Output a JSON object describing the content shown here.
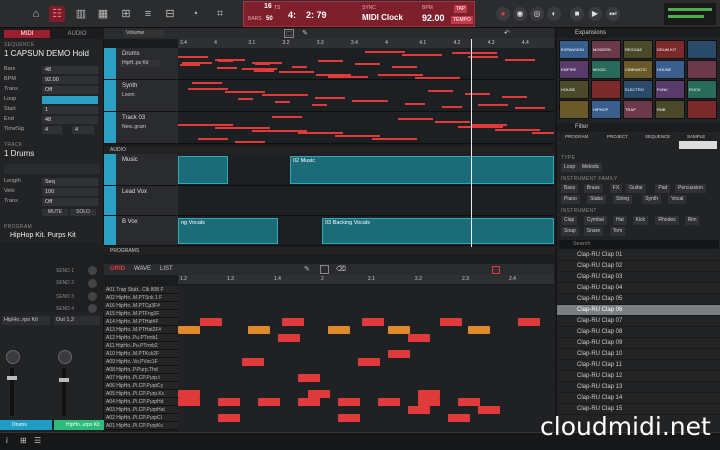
{
  "toolbar": {
    "ts_label": "TS",
    "ts_num": "16",
    "bars_label": "BARS",
    "bars_val": "4:",
    "bars_label2": "50",
    "pos_val": "2:  79",
    "sync_label": "SYNC",
    "sync_val": "MIDI Clock",
    "bpm_label": "BPM",
    "bpm_val": "92.00",
    "tap_label": "TAP",
    "tempo_label": "TEMPO"
  },
  "left": {
    "tab_midi": "MIDI",
    "tab_audio": "AUDIO",
    "seq_hdr": "SEQUENCE",
    "seq_name": "1 CAPSUN DEMO Hold",
    "rows": [
      {
        "k": "Bars",
        "v": "48"
      },
      {
        "k": "BPM",
        "v": "92.00"
      },
      {
        "k": "Trans",
        "v": "Off"
      },
      {
        "k": "Loop",
        "v": ""
      },
      {
        "k": "Start",
        "v": "1"
      },
      {
        "k": "End",
        "v": "48"
      },
      {
        "k": "TimeSig",
        "v": "4"
      }
    ],
    "timesig_den": "4",
    "track_hdr": "TRACK",
    "track_name": "1 Drums",
    "trows": [
      {
        "k": "Length",
        "v": "Seq"
      },
      {
        "k": "Velo",
        "v": "100"
      },
      {
        "k": "Trans",
        "v": "Off"
      }
    ],
    "mute": "MUTE",
    "solo": "SOLO",
    "prog_hdr": "PROGRAM",
    "prog_name": "HipHop Kit. Purps Kit",
    "sends": [
      "SEND 1",
      "SEND 2",
      "SEND 3",
      "SEND 4"
    ],
    "kit_sel": "HipHo..rps Kit",
    "out_sel": "Out 1,2",
    "ch1": "Drums",
    "ch2": "HipHo..urps Kit"
  },
  "tracks": {
    "view": "Volume",
    "ruler": [
      "3.4",
      "4",
      "3.1",
      "3.2",
      "3.3",
      "3.4",
      "4",
      "4.1",
      "4.2",
      "4.3",
      "4.4"
    ],
    "t1": "Drums",
    "t1_prog": "HipH..ps Kit",
    "t2": "Synth",
    "t2_prog": "Loom",
    "t3": "Track 03",
    "t3_prog": "New..gram",
    "audio_hdr": "AUDIO",
    "a1": "Music",
    "a2": "Lead Vox",
    "a3": "B Vox",
    "clip_music": "02 Music",
    "clip_bv1": "ng Vocals",
    "clip_bv2": "03 Backing Vocals",
    "prog_hdr": "PROGRAMS"
  },
  "grid": {
    "tab_grid": "GRID",
    "tab_wave": "WAVE",
    "tab_list": "LIST",
    "ruler": [
      "1.2",
      "1.3",
      "1.4",
      "2",
      "2.1",
      "2.2",
      "2.3",
      "2.4"
    ],
    "pads": [
      "A01 Trap Stutt.. Clk 808 F",
      "A02 HipHo..M.PTSnk 1 F",
      "A16 HipHo..M.PTCp3F#",
      "A15 HipHo..M.PTFng1F",
      "A14 HipHo..M.PTHat#F",
      "A13 HipHo..M.PTHat2F#",
      "A12 HipHo..Pu.PTrmb1",
      "A11 HipHo..Pu.PTrmb2",
      "A10 HipHo..M.PTKck2F",
      "A09 HipHo..Vo.PVoc1F",
      "A08 HipHo..P.Purp.Thd",
      "A07 HipHo..Pi.CP.Purp.t",
      "A06 HipHo..Pi.CP.PurpCy",
      "A05 HipHo..Pi.CP.Purp.Kc",
      "A04 HipHo..Pi.CP.PurpHd",
      "A03 HipHo..Pi.CP.PurpHat",
      "A02 HipHo..Pi.CP.PurpCl",
      "A01 HipHo..Pi.CP.PurpKs"
    ]
  },
  "right": {
    "exp_hdr": "Expansions",
    "filter_hdr": "Filter",
    "ftabs": [
      "PROGRAM",
      "PROJECT",
      "SEQUENCE",
      "SAMPLE"
    ],
    "type_hdr": "TYPE",
    "type": [
      "Loop",
      "Melodic"
    ],
    "fam_hdr": "INSTRUMENT FAMILY",
    "fam": [
      "Bass",
      "Brass",
      "FX",
      "Guitar",
      "Pad",
      "Percussion",
      "Piano",
      "Stabs",
      "String",
      "Synth",
      "Vocal"
    ],
    "inst_hdr": "INSTRUMENT",
    "inst": [
      "Clap",
      "Cymbal",
      "Hat",
      "Kick",
      "Rhodes",
      "Rim",
      "Snap",
      "Snare",
      "Tom"
    ],
    "search": "Search",
    "clips": [
      "Clap-RU Clap 01",
      "Clap-RU Clap 02",
      "Clap-RU Clap 03",
      "Clap-RU Clap 04",
      "Clap-RU Clap 05",
      "Clap-RU Clap 06",
      "Clap-RU Clap 07",
      "Clap-RU Clap 08",
      "Clap-RU Clap 09",
      "Clap-RU Clap 10",
      "Clap-RU Clap 11",
      "Clap-RU Clap 12",
      "Clap-RU Clap 13",
      "Clap-RU Clap 14",
      "Clap-RU Clap 15"
    ],
    "thumbs": [
      "EXPANSION",
      "MODERN",
      "REGGAE",
      "DRUM KIT",
      "",
      "EMPIRE",
      "MOOG",
      "CINEMATIC",
      "HOUSE",
      "",
      "HOUSE",
      "",
      "ELECTRO",
      "FUNK",
      "ROCK",
      "",
      "HIPHOP",
      "TRAP",
      "RNB",
      ""
    ]
  },
  "watermark": "cloudmidi.net",
  "colors": {
    "accent": "#e03a3a",
    "cyan": "#2c9fc5",
    "teal": "#1c6b78"
  }
}
